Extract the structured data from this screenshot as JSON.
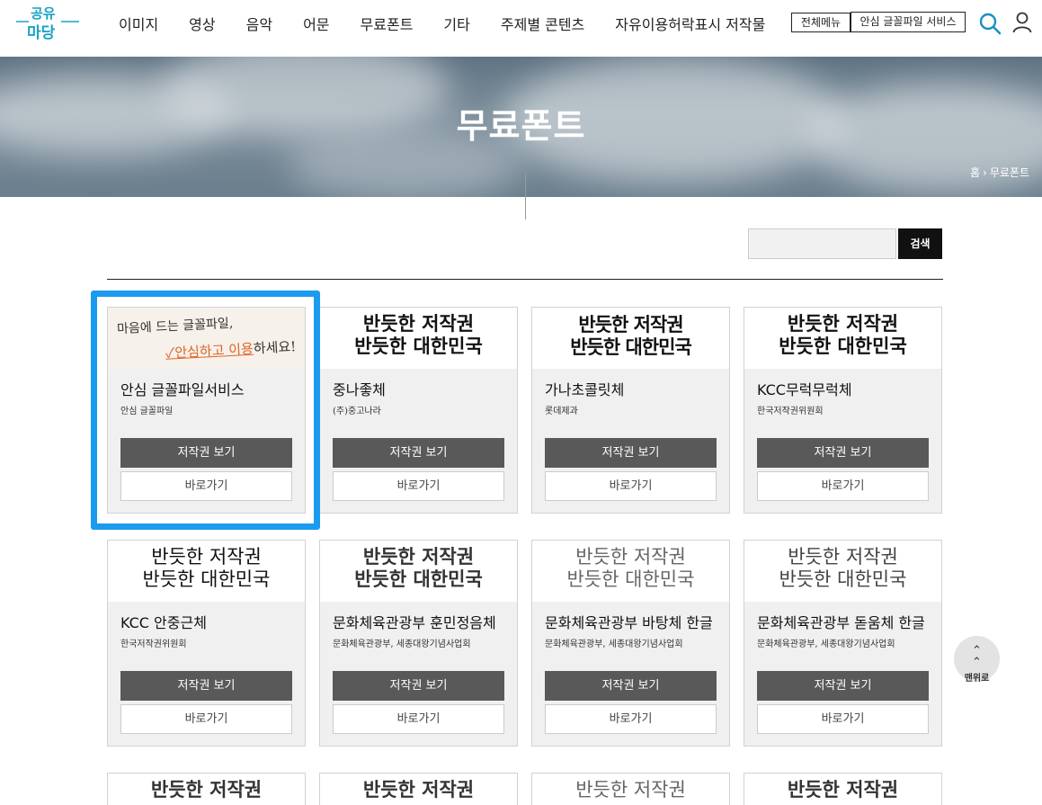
{
  "header": {
    "logo_text": "공유마당",
    "nav": [
      "이미지",
      "영상",
      "음악",
      "어문",
      "무료폰트",
      "기타",
      "주제별 콘텐츠",
      "자유이용허락표시 저작물"
    ],
    "all_menu_label": "전체메뉴",
    "safe_font_label": "안심 글꼴파일 서비스"
  },
  "banner": {
    "title": "무료폰트",
    "breadcrumb_home": "홈",
    "breadcrumb_current": "무료폰트"
  },
  "search": {
    "placeholder": "",
    "button_label": "검색"
  },
  "cards": [
    {
      "name": "안심 글꼴파일서비스",
      "maker": "안심 글꼴파일",
      "sample": "",
      "promo_line1": "마음에 드는 글꼴파일,",
      "promo_line2_hl": "✓안심하고 이용",
      "promo_line2_rest": "하세요!",
      "copyright_label": "저작권 보기",
      "go_label": "바로가기"
    },
    {
      "name": "중나좋체",
      "maker": "(주)중고나라",
      "sample": "반듯한 저작권\n반듯한 대한민국",
      "copyright_label": "저작권 보기",
      "go_label": "바로가기"
    },
    {
      "name": "가나초콜릿체",
      "maker": "롯데제과",
      "sample": "반듯한 저작권\n반듯한 대한민국",
      "copyright_label": "저작권 보기",
      "go_label": "바로가기"
    },
    {
      "name": "KCC무럭무럭체",
      "maker": "한국저작권위원회",
      "sample": "반듯한 저작권\n반듯한 대한민국",
      "copyright_label": "저작권 보기",
      "go_label": "바로가기"
    },
    {
      "name": "KCC 안중근체",
      "maker": "한국저작권위원회",
      "sample": "반듯한 저작권\n반듯한 대한민국",
      "copyright_label": "저작권 보기",
      "go_label": "바로가기"
    },
    {
      "name": "문화체육관광부 훈민정음체",
      "maker": "문화체육관광부, 세종대왕기념사업회",
      "sample": "반듯한 저작권\n반듯한 대한민국",
      "copyright_label": "저작권 보기",
      "go_label": "바로가기"
    },
    {
      "name": "문화체육관광부 바탕체 한글",
      "maker": "문화체육관광부, 세종대왕기념사업회",
      "sample": "반듯한 저작권\n반듯한 대한민국",
      "copyright_label": "저작권 보기",
      "go_label": "바로가기"
    },
    {
      "name": "문화체육관광부 돋움체 한글",
      "maker": "문화체육관광부, 세종대왕기념사업회",
      "sample": "반듯한 저작권\n반듯한 대한민국",
      "copyright_label": "저작권 보기",
      "go_label": "바로가기"
    },
    {
      "name": "",
      "maker": "",
      "sample": "반듯한 저작권",
      "copyright_label": "",
      "go_label": ""
    },
    {
      "name": "",
      "maker": "",
      "sample": "반듯한 저작권",
      "copyright_label": "",
      "go_label": ""
    },
    {
      "name": "",
      "maker": "",
      "sample": "반듯한 저작권",
      "copyright_label": "",
      "go_label": ""
    },
    {
      "name": "",
      "maker": "",
      "sample": "반듯한 저작권",
      "copyright_label": "",
      "go_label": ""
    }
  ],
  "top_button_label": "맨위로",
  "colors": {
    "highlight": "#1b9bf0",
    "button_dark": "#595959",
    "search_button": "#111111"
  }
}
